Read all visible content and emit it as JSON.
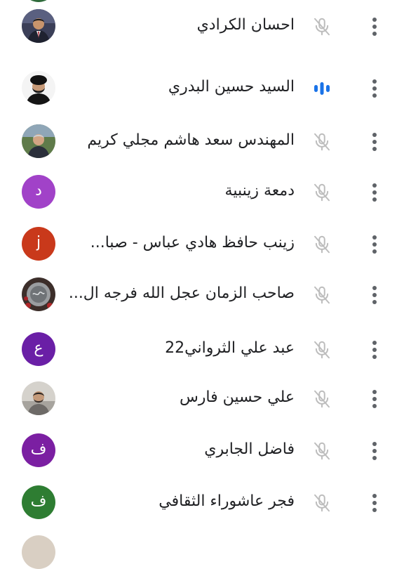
{
  "participants": [
    {
      "name": "احسان الكرادي",
      "avatar": {
        "type": "photo",
        "icon": "person-photo-suit"
      },
      "status": "muted"
    },
    {
      "name": "السيد حسين البدري",
      "avatar": {
        "type": "photo",
        "icon": "person-photo-cleric"
      },
      "status": "speaking"
    },
    {
      "name": "المهندس سعد هاشم مجلي كريم",
      "avatar": {
        "type": "photo",
        "icon": "person-photo-outdoor"
      },
      "status": "muted"
    },
    {
      "name": "دمعة زينبية",
      "avatar": {
        "type": "letter",
        "letter": "د",
        "color": "#a142c8"
      },
      "status": "muted"
    },
    {
      "name": "زينب حافظ هادي عباس - صبا...",
      "avatar": {
        "type": "letter",
        "letter": "j",
        "color": "#c9391b"
      },
      "status": "muted"
    },
    {
      "name": "صاحب الزمان عجل الله فرجه ال...",
      "avatar": {
        "type": "photo",
        "icon": "emblem-photo"
      },
      "status": "muted"
    },
    {
      "name": "عبد علي الثرواني22",
      "avatar": {
        "type": "letter",
        "letter": "ع",
        "color": "#6a1fa6"
      },
      "status": "muted"
    },
    {
      "name": "علي حسين فارس",
      "avatar": {
        "type": "photo",
        "icon": "person-photo-casual"
      },
      "status": "muted"
    },
    {
      "name": "فاضل الجابري",
      "avatar": {
        "type": "letter",
        "letter": "ف",
        "color": "#7b1fa2"
      },
      "status": "muted"
    },
    {
      "name": "فجر عاشوراء الثقافي",
      "avatar": {
        "type": "letter",
        "letter": "ف",
        "color": "#2e7d32"
      },
      "status": "muted"
    }
  ],
  "icons": {
    "muted": "mic-off-icon",
    "speaking": "audio-level-icon",
    "more": "more-vert-icon"
  },
  "colors": {
    "muted_icon": "#bdbdbd",
    "speaking_icon": "#1a73e8",
    "more_icon": "#5f6368",
    "text": "#202124"
  }
}
